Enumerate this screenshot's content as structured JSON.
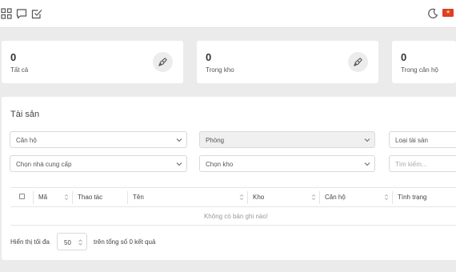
{
  "topbar": {
    "left_icons": [
      "grid-icon",
      "chat-icon",
      "checkbox-icon"
    ],
    "right_icons": [
      "moon-icon",
      "flag-vietnam-icon"
    ]
  },
  "stats": [
    {
      "value": "0",
      "label": "Tất cả"
    },
    {
      "value": "0",
      "label": "Trong kho"
    },
    {
      "value": "0",
      "label": "Trong căn hộ"
    }
  ],
  "panel": {
    "title": "Tài sản",
    "filters": {
      "apartment": "Căn hộ",
      "room": "Phòng",
      "asset_type": "Loại tài sản",
      "supplier": "Chọn nhà cung cấp",
      "warehouse": "Chọn kho",
      "search_placeholder": "Tìm kiếm..."
    },
    "table": {
      "columns": [
        "Mã",
        "Thao tác",
        "Tên",
        "Kho",
        "Căn hộ",
        "Tình trạng"
      ],
      "empty_message": "Không có bản ghi nào!"
    },
    "footer": {
      "show_label": "Hiển thị tối đa",
      "page_size": "50",
      "total_text": "trên tổng số 0 kết quả"
    }
  },
  "colors": {
    "background": "#ebebeb",
    "card": "#ffffff",
    "flag": "#e03b30"
  }
}
